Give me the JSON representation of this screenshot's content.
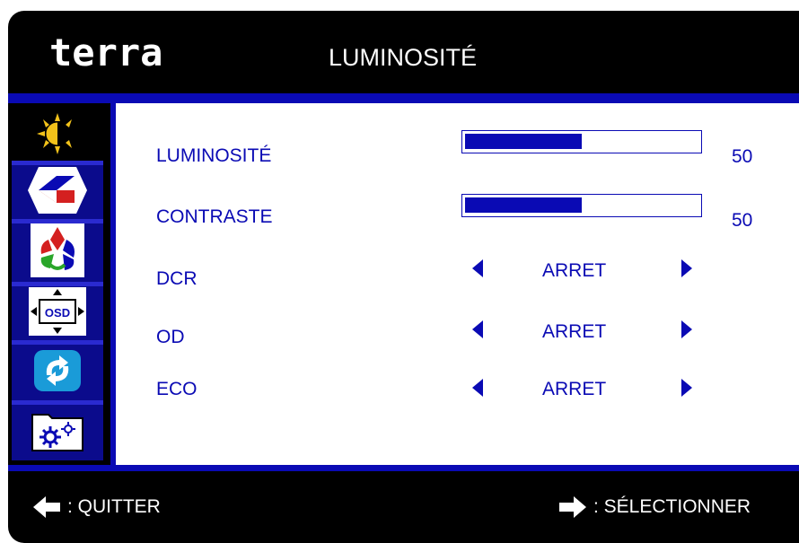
{
  "header": {
    "logo": "terra",
    "title": "LUMINOSITÉ"
  },
  "sidebar": {
    "items": [
      {
        "icon": "brightness-icon",
        "active": true
      },
      {
        "icon": "image-setup-icon",
        "active": false
      },
      {
        "icon": "color-icon",
        "active": false
      },
      {
        "icon": "osd-position-icon",
        "active": false
      },
      {
        "icon": "reset-icon",
        "active": false
      },
      {
        "icon": "settings-icon",
        "active": false
      }
    ]
  },
  "menu": {
    "brightness": {
      "label": "LUMINOSITÉ",
      "value": "50",
      "level": 0.5
    },
    "contrast": {
      "label": "CONTRASTE",
      "value": "50",
      "level": 0.5
    },
    "dcr": {
      "label": "DCR",
      "option": "ARRET"
    },
    "od": {
      "label": "OD",
      "option": "ARRET"
    },
    "eco": {
      "label": "ECO",
      "option": "ARRET"
    }
  },
  "footer": {
    "quit_label": ": QUITTER",
    "select_label": ": SÉLECTIONNER"
  },
  "colors": {
    "accent": "#0a0ab4",
    "background": "#000000",
    "panel": "#ffffff"
  }
}
